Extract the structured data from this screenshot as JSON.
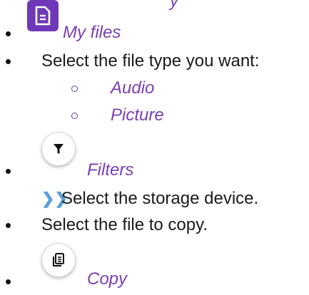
{
  "header_fragment": "y",
  "items": {
    "my_files": {
      "label": "My files",
      "icon": "document-icon"
    },
    "select_type": {
      "text": "Select the file type you want:"
    },
    "audio": {
      "label": "Audio"
    },
    "picture": {
      "label": "Picture"
    },
    "filters": {
      "label": "Filters",
      "icon": "filter-icon"
    },
    "storage": {
      "marker": "❯❯",
      "text": "Select the storage device."
    },
    "select_file": {
      "text": "Select the file to copy."
    },
    "copy": {
      "label": "Copy",
      "icon": "copy-icon"
    }
  },
  "colors": {
    "accent_purple": "#7a3fb0",
    "icon_bg": "#6f38b8",
    "chevron_blue": "#5aa0d8"
  }
}
